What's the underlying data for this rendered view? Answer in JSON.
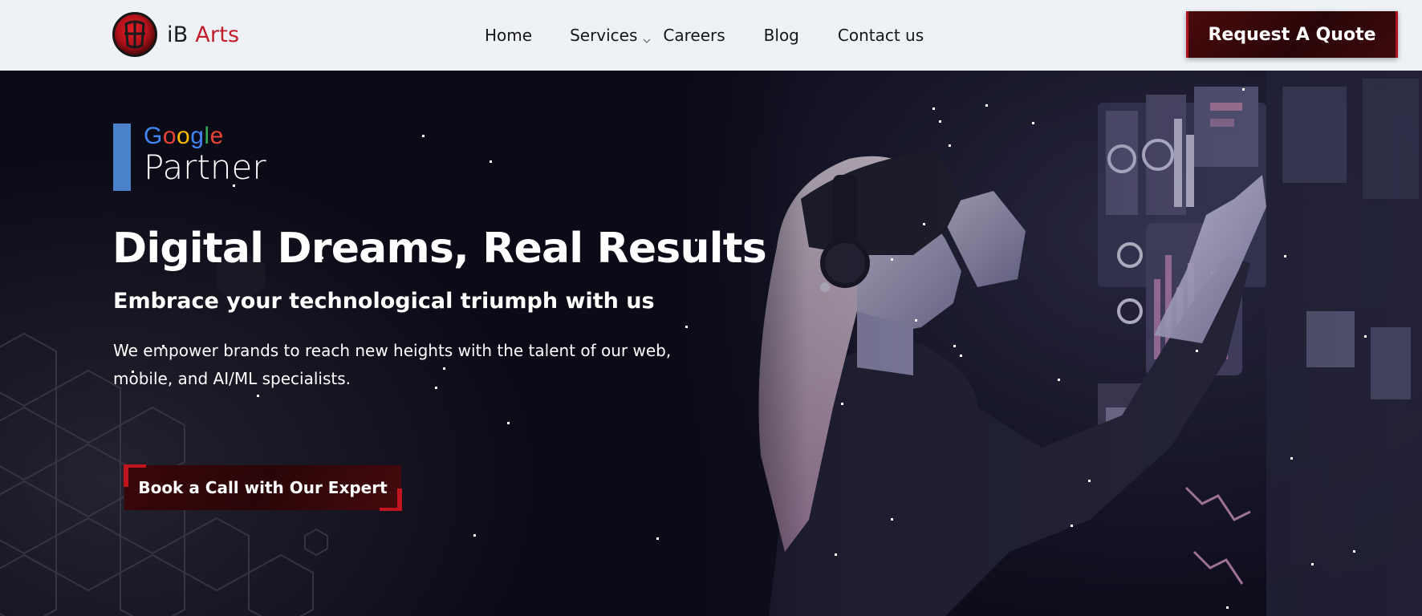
{
  "header": {
    "logo": {
      "text_ib": "iB",
      "text_arts": "Arts"
    },
    "nav": [
      {
        "label": "Home"
      },
      {
        "label": "Services"
      },
      {
        "label": "Careers"
      },
      {
        "label": "Blog"
      },
      {
        "label": "Contact us"
      }
    ],
    "quote_button": "Request A Quote"
  },
  "hero": {
    "badge": {
      "google": [
        "G",
        "o",
        "o",
        "g",
        "l",
        "e"
      ],
      "partner": "Partner"
    },
    "title": "Digital Dreams, Real Results",
    "subtitle": "Embrace your technological triumph with us",
    "description": "We empower brands to reach new heights with the talent of our web, mobile, and AI/ML specialists.",
    "cta": "Book a Call with Our Expert"
  },
  "colors": {
    "header_bg": "#eef2f6",
    "brand_red": "#c21d2a",
    "hero_bg": "#0b0a17",
    "button_dark_red": "#2a0507",
    "google_bar_blue": "#4a82c9"
  },
  "icons": [
    "logo-mark-icon",
    "chevron-down-icon",
    "hex-pattern",
    "vr-headset-illustration"
  ]
}
